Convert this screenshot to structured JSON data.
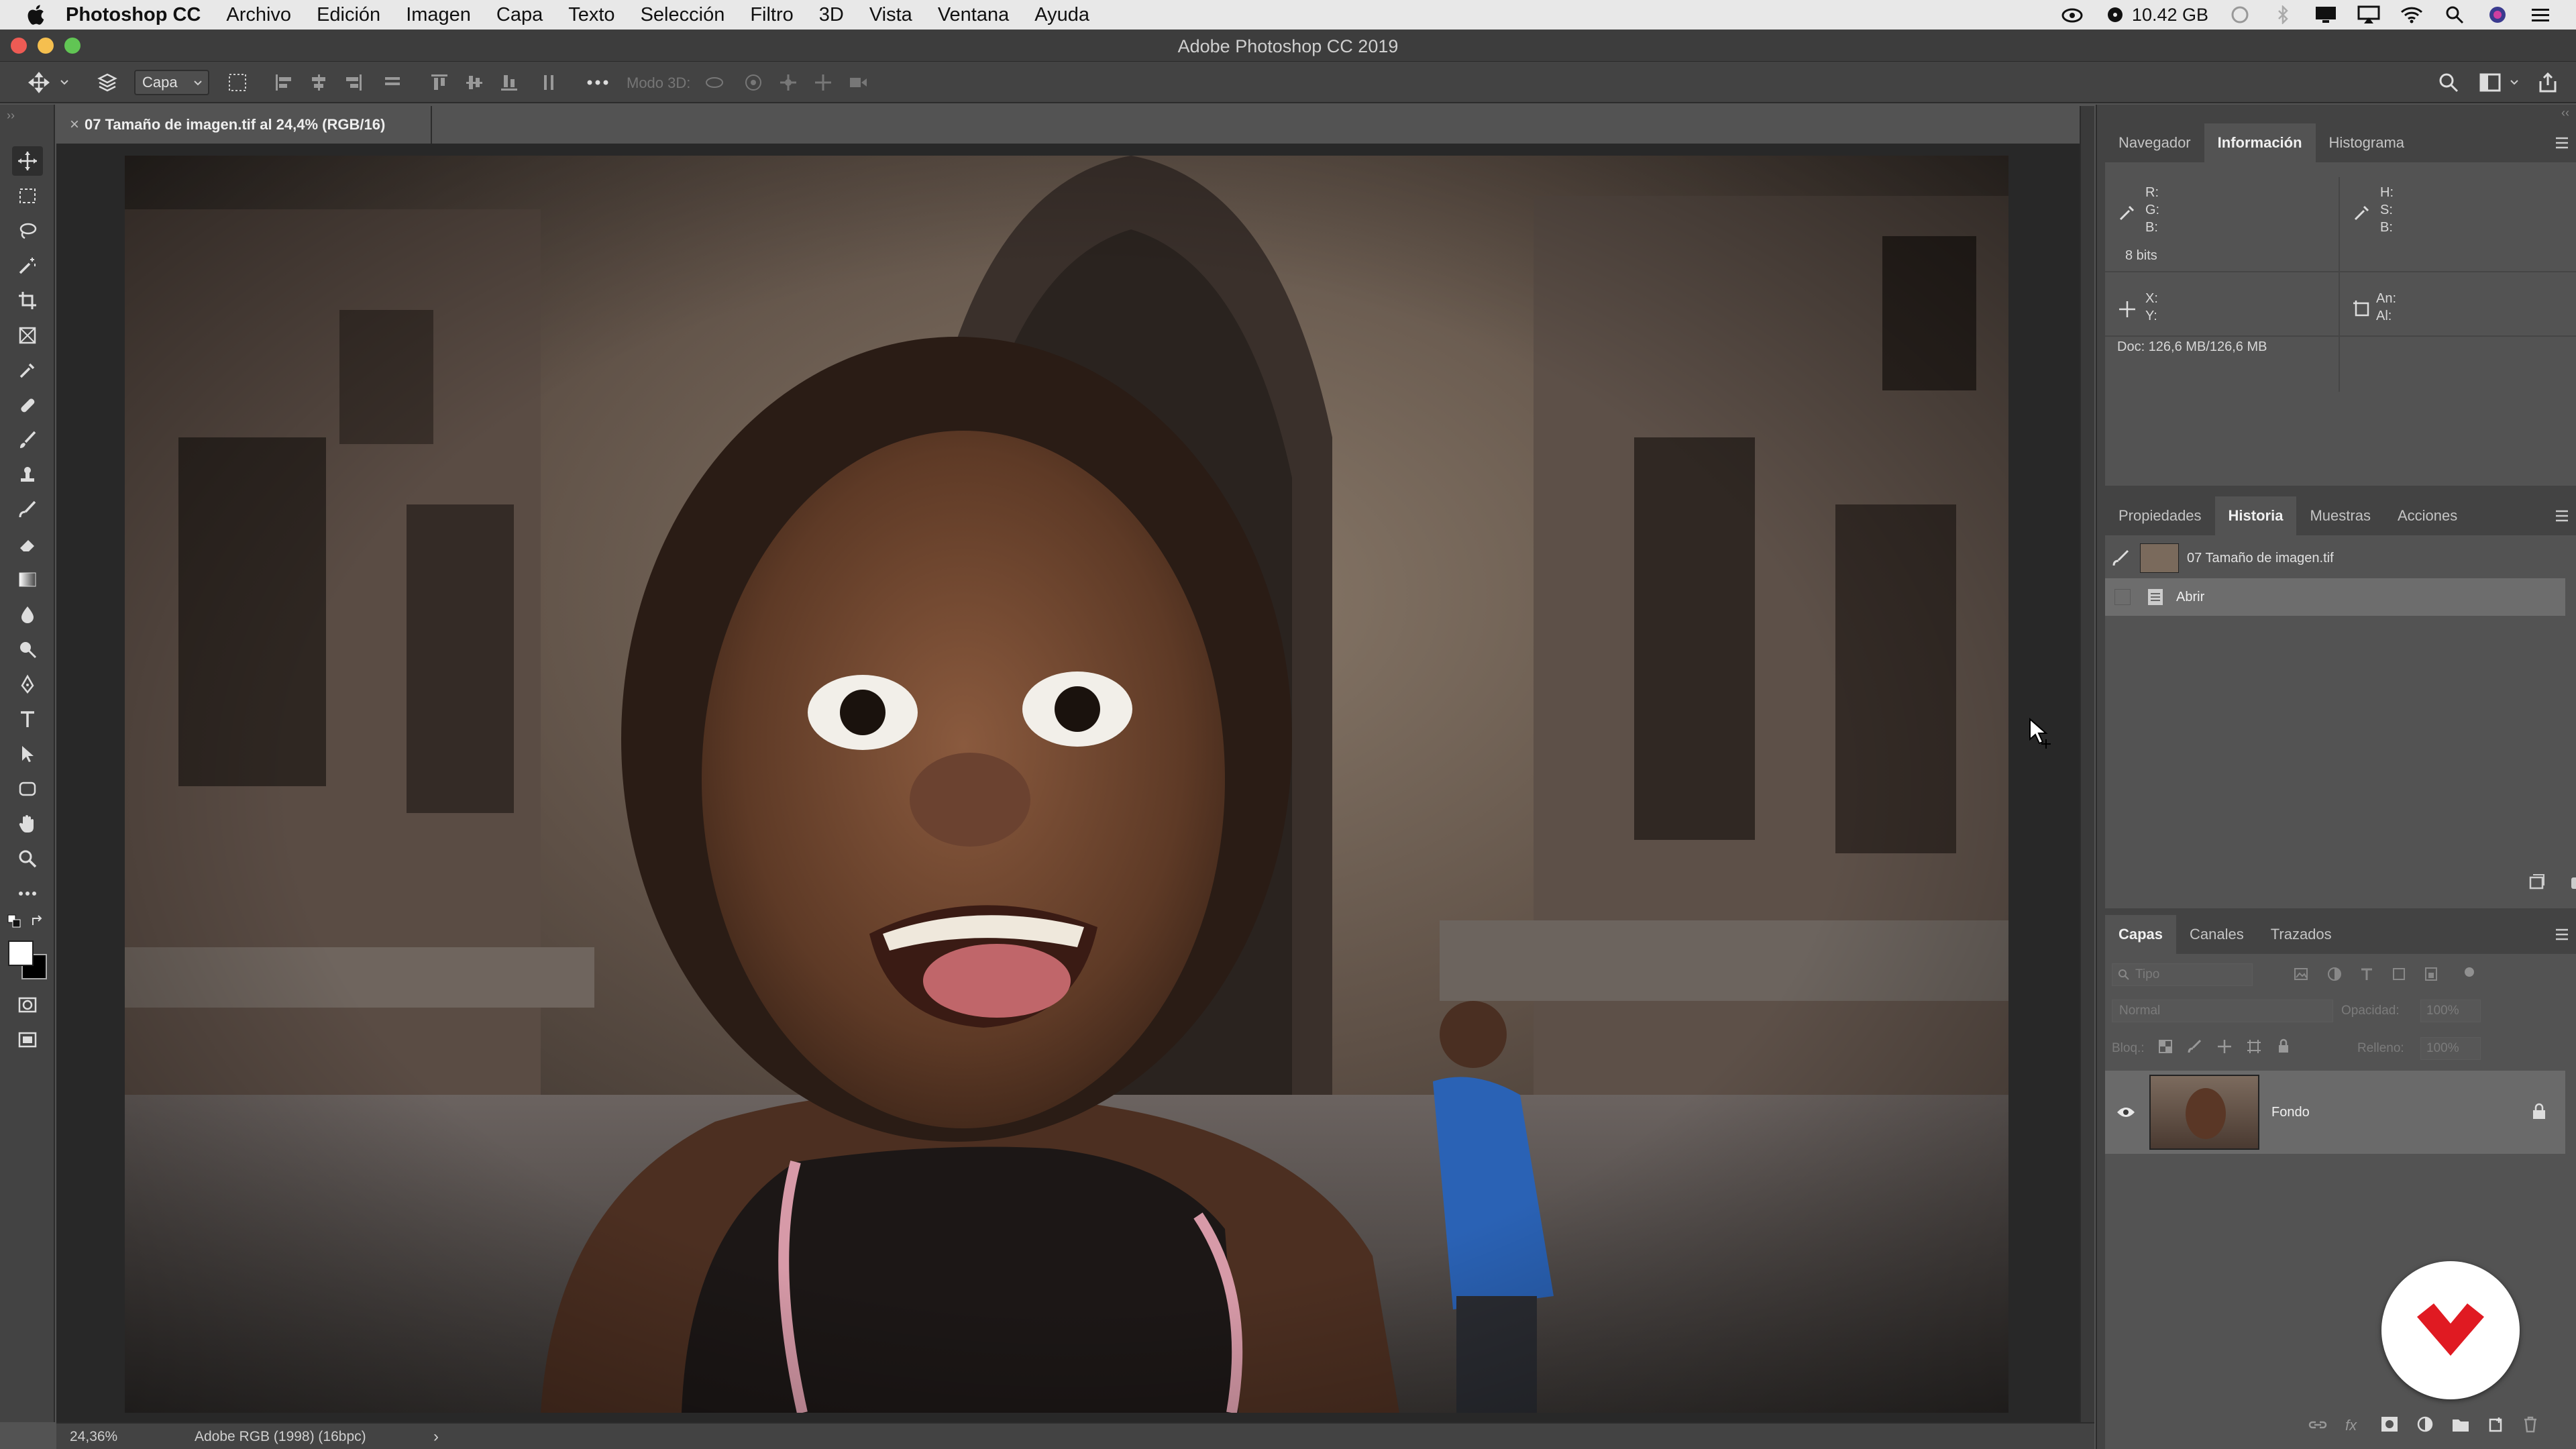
{
  "menubar": {
    "app_name": "Photoshop CC",
    "menus": [
      "Archivo",
      "Edición",
      "Imagen",
      "Capa",
      "Texto",
      "Selección",
      "Filtro",
      "3D",
      "Vista",
      "Ventana",
      "Ayuda"
    ],
    "storage": "10.42 GB"
  },
  "titlebar": {
    "title": "Adobe Photoshop CC 2019"
  },
  "options": {
    "layer_select": "Capa",
    "mode_3d": "Modo 3D:"
  },
  "document": {
    "tab_title": "07 Tamaño de imagen.tif al 24,4% (RGB/16)",
    "zoom": "24,36%",
    "color_profile": "Adobe RGB (1998) (16bpc)"
  },
  "info_panel": {
    "tabs": [
      "Navegador",
      "Información",
      "Histograma"
    ],
    "active_tab": "Información",
    "rgb_labels": [
      "R:",
      "G:",
      "B:"
    ],
    "hsb_labels": [
      "H:",
      "S:",
      "B:"
    ],
    "bits": "8 bits",
    "xy_labels": [
      "X:",
      "Y:"
    ],
    "size_labels": [
      "An:",
      "Al:"
    ],
    "doc_size": "Doc: 126,6 MB/126,6 MB"
  },
  "history_panel": {
    "tabs": [
      "Propiedades",
      "Historia",
      "Muestras",
      "Acciones"
    ],
    "active_tab": "Historia",
    "snapshot": "07 Tamaño de imagen.tif",
    "states": [
      "Abrir"
    ]
  },
  "layers_panel": {
    "tabs": [
      "Capas",
      "Canales",
      "Trazados"
    ],
    "active_tab": "Capas",
    "filter_placeholder": "Tipo",
    "blend_mode": "Normal",
    "opacity_label": "Opacidad:",
    "opacity_value": "100%",
    "lock_label": "Bloq.:",
    "fill_label": "Relleno:",
    "fill_value": "100%",
    "layers": [
      {
        "name": "Fondo",
        "locked": true,
        "visible": true
      }
    ]
  },
  "colors": {
    "accent_red": "#e01a22",
    "panel_bg": "#535353",
    "dock_bg": "#434343"
  }
}
